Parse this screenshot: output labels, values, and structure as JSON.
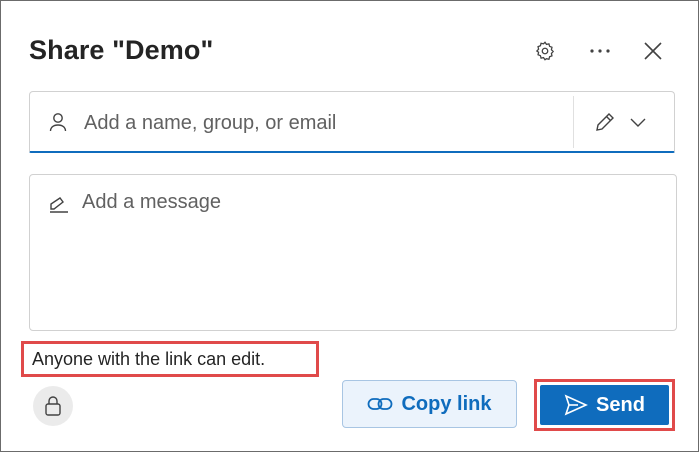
{
  "dialog": {
    "title": "Share \"Demo\""
  },
  "header": {
    "settings_icon": "gear-icon",
    "more_icon": "more-options-icon",
    "close_icon": "close-icon"
  },
  "recipients": {
    "placeholder": "Add a name, group, or email",
    "value": "",
    "permission_icon": "pencil-icon",
    "permission_dropdown_icon": "chevron-down-icon"
  },
  "message": {
    "placeholder": "Add a message",
    "value": ""
  },
  "link_settings": {
    "text": "Anyone with the link can edit."
  },
  "footer": {
    "lock_icon": "lock-icon",
    "copy_link_label": "Copy link",
    "send_label": "Send"
  },
  "colors": {
    "accent": "#0f6cbd",
    "highlight": "#e04a4a",
    "copy_bg": "#ebf3fc"
  }
}
